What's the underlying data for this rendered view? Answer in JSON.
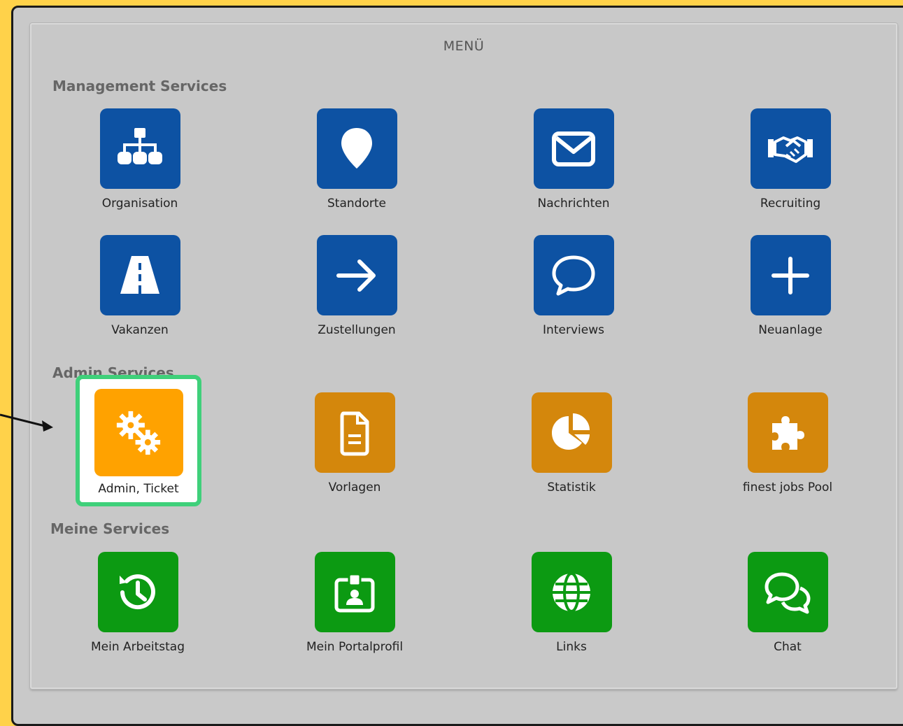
{
  "menu": {
    "title": "MENÜ"
  },
  "sections": {
    "management": {
      "title": "Management Services",
      "color": "#0d52a3",
      "items": [
        {
          "label": "Organisation",
          "icon": "org-chart-icon"
        },
        {
          "label": "Standorte",
          "icon": "map-pin-icon"
        },
        {
          "label": "Nachrichten",
          "icon": "envelope-icon"
        },
        {
          "label": "Recruiting",
          "icon": "handshake-icon"
        },
        {
          "label": "Vakanzen",
          "icon": "road-icon"
        },
        {
          "label": "Zustellungen",
          "icon": "arrow-right-icon"
        },
        {
          "label": "Interviews",
          "icon": "speech-bubble-icon"
        },
        {
          "label": "Neuanlage",
          "icon": "plus-icon"
        }
      ]
    },
    "admin": {
      "title": "Admin Services",
      "color": "#d4870c",
      "highlight_color": "#ffa200",
      "items": [
        {
          "label": "Admin, Ticket",
          "icon": "gears-icon"
        },
        {
          "label": "Vorlagen",
          "icon": "document-icon"
        },
        {
          "label": "Statistik",
          "icon": "pie-chart-icon"
        },
        {
          "label": "finest jobs Pool",
          "icon": "puzzle-icon"
        }
      ]
    },
    "meine": {
      "title": "Meine Services",
      "color": "#0c9a12",
      "items": [
        {
          "label": "Mein Arbeitstag",
          "icon": "history-clock-icon"
        },
        {
          "label": "Mein Portalprofil",
          "icon": "id-badge-icon"
        },
        {
          "label": "Links",
          "icon": "globe-icon"
        },
        {
          "label": "Chat",
          "icon": "chat-bubbles-icon"
        }
      ]
    }
  },
  "annotation": {
    "highlight_border": "#3fd07a"
  }
}
